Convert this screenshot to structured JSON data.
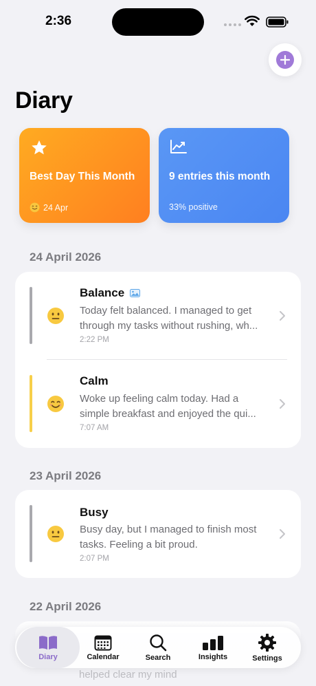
{
  "status_bar": {
    "time": "2:36"
  },
  "header": {
    "title": "Diary"
  },
  "summary": {
    "best_day": {
      "title": "Best Day This Month",
      "date": "24 Apr"
    },
    "entries": {
      "title": "9 entries this month",
      "subtitle": "33% positive"
    }
  },
  "sections": [
    {
      "date": "24 April 2026",
      "entries": [
        {
          "title": "Balance",
          "line1": "Today felt balanced. I managed to get",
          "line2": "through my tasks without rushing, wh...",
          "time": "2:22 PM"
        },
        {
          "title": "Calm",
          "line1": "Woke up feeling calm today. Had a",
          "line2": "simple breakfast and enjoyed the qui...",
          "time": "7:07 AM"
        }
      ]
    },
    {
      "date": "23 April 2026",
      "entries": [
        {
          "title": "Busy",
          "line1": "Busy day, but I managed to finish most",
          "line2": "tasks. Feeling a bit proud.",
          "time": "2:07 PM"
        }
      ]
    },
    {
      "date": "22 April 2026",
      "entries": [
        {
          "peek_text": "helped clear my mind"
        }
      ]
    }
  ],
  "tabs": [
    {
      "label": "Diary"
    },
    {
      "label": "Calendar"
    },
    {
      "label": "Search"
    },
    {
      "label": "Insights"
    },
    {
      "label": "Settings"
    }
  ],
  "colors": {
    "accent": "#a07ad8",
    "best_day_card": "#ff9520",
    "entries_card": "#4f8df3",
    "mood_neutral": "#a9a9ae",
    "mood_calm": "#f7cf4a"
  }
}
